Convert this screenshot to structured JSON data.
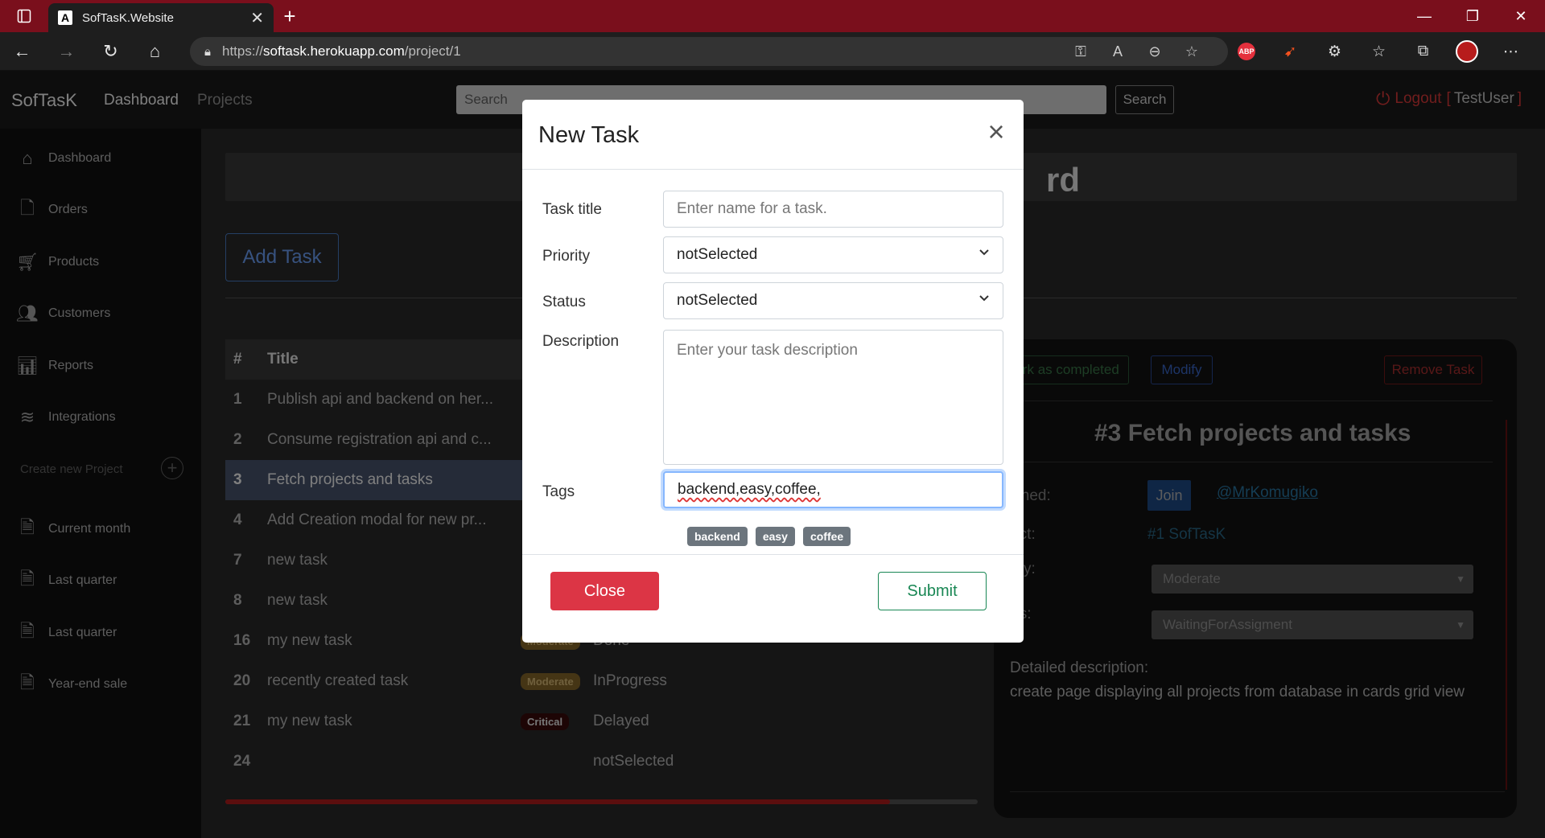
{
  "browser": {
    "tab_title": "SofTasK.Website",
    "url_prefix": "https://",
    "url_host": "softask.herokuapp.com",
    "url_path": "/project/1"
  },
  "header": {
    "brand": "SofTasK",
    "nav": [
      "Dashboard",
      "Projects"
    ],
    "search_placeholder": "Search",
    "search_button": "Search",
    "logout": "Logout",
    "bracket_open": "[",
    "user": "TestUser",
    "bracket_close": "]"
  },
  "sidebar": {
    "items": [
      "Dashboard",
      "Orders",
      "Products",
      "Customers",
      "Reports",
      "Integrations"
    ],
    "section_label": "Create new Project",
    "saved": [
      "Current month",
      "Last quarter",
      "Last quarter",
      "Year-end sale"
    ]
  },
  "main": {
    "title_fragment": "rd",
    "add_task": "Add Task",
    "table": {
      "headers": [
        "#",
        "Title"
      ],
      "rows": [
        {
          "id": "1",
          "title": "Publish api and backend on her...",
          "priority": "",
          "status": ""
        },
        {
          "id": "2",
          "title": "Consume registration api and c...",
          "priority": "",
          "status": ""
        },
        {
          "id": "3",
          "title": "Fetch projects and tasks",
          "priority": "",
          "status": ""
        },
        {
          "id": "4",
          "title": "Add Creation modal for new pr...",
          "priority": "",
          "status": ""
        },
        {
          "id": "7",
          "title": "new task",
          "priority": "",
          "status": ""
        },
        {
          "id": "8",
          "title": "new task",
          "priority": "",
          "status": ""
        },
        {
          "id": "16",
          "title": "my new task",
          "priority": "Moderate",
          "status": "Done"
        },
        {
          "id": "20",
          "title": "recently created task",
          "priority": "Moderate",
          "status": "InProgress"
        },
        {
          "id": "21",
          "title": "my new task",
          "priority": "Critical",
          "status": "Delayed"
        },
        {
          "id": "24",
          "title": "",
          "priority": "",
          "status": "notSelected"
        }
      ]
    },
    "progress": 0.883,
    "detail": {
      "btn_complete": "Mark as completed",
      "btn_modify": "Modify",
      "btn_remove": "Remove Task",
      "title": "#3 Fetch projects and tasks",
      "assigned_label": "ssigned:",
      "join": "Join",
      "mention": "@MrKomugiko",
      "project_label": "roject:",
      "project": "#1 SofTasK",
      "priority_label": "riority:",
      "priority": "Moderate",
      "status_label": "tatus:",
      "status": "WaitingForAssigment",
      "desc_label": "Detailed description:",
      "description": "create page displaying all projects from database in cards grid view"
    }
  },
  "modal": {
    "title": "New Task",
    "fields": {
      "title_label": "Task title",
      "title_placeholder": "Enter name for a task.",
      "priority_label": "Priority",
      "priority_value": "notSelected",
      "status_label": "Status",
      "status_value": "notSelected",
      "desc_label": "Description",
      "desc_placeholder": "Enter your task description",
      "tags_label": "Tags",
      "tags_value": "backend,easy,coffee,"
    },
    "tags": [
      "backend",
      "easy",
      "coffee"
    ],
    "close": "Close",
    "submit": "Submit"
  }
}
